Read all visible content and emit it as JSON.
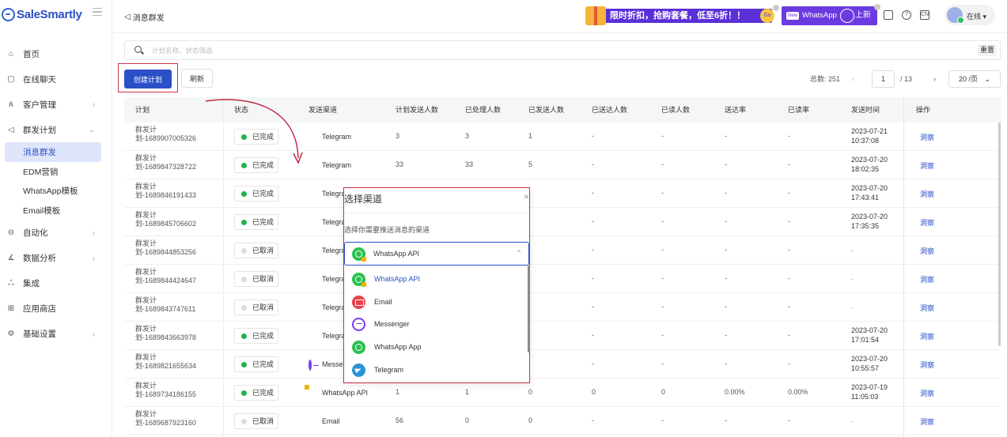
{
  "app": {
    "logo": "SaleSmartly"
  },
  "sidebar": {
    "items": [
      {
        "label": "首页",
        "icon": "home-icon",
        "glyph": "⌂"
      },
      {
        "label": "在线聊天",
        "icon": "chat-icon",
        "glyph": "▢"
      },
      {
        "label": "客户管理",
        "icon": "users-icon",
        "glyph": "ጰ",
        "chev": "›"
      },
      {
        "label": "群发计划",
        "icon": "send-icon",
        "glyph": "◁",
        "chev": "⌄"
      },
      {
        "label": "自动化",
        "icon": "automation-icon",
        "glyph": "⊖",
        "chev": "›"
      },
      {
        "label": "数据分析",
        "icon": "analytics-icon",
        "glyph": "∡",
        "chev": "›"
      },
      {
        "label": "集成",
        "icon": "integration-icon",
        "glyph": "ஃ"
      },
      {
        "label": "应用商店",
        "icon": "store-icon",
        "glyph": "⊞"
      },
      {
        "label": "基础设置",
        "icon": "settings-icon",
        "glyph": "⚙",
        "chev": "›"
      }
    ],
    "sub_items": [
      "消息群发",
      "EDM营销",
      "WhatsApp模板",
      "Email模板"
    ]
  },
  "topbar": {
    "title": "消息群发",
    "promo_text": "限时折扣，抢购套餐，低至6折！！",
    "promo_badge": "Go",
    "wa_new": "New",
    "wa_label": "WhatsApp",
    "wa_suffix": "上新",
    "icon_cn": "CN",
    "icon_help": "?",
    "user_status": "在线"
  },
  "search": {
    "placeholder": "计划名称、状态筛选",
    "reset": "重置"
  },
  "toolbar": {
    "create": "创建计划",
    "refresh": "刷新"
  },
  "pager": {
    "total_label": "总数: 251",
    "prev": "‹",
    "page": "1",
    "of": "/ 13",
    "next": "›",
    "page_size": "20 /页",
    "page_size_chev": "⌄"
  },
  "table": {
    "headers": [
      "计划",
      "状态",
      "发送渠道",
      "计划发送人数",
      "已处理人数",
      "已发送人数",
      "已送达人数",
      "已读人数",
      "送达率",
      "已读率",
      "发送时间",
      "操作"
    ],
    "rows": [
      {
        "plan1": "群发计",
        "plan2": "划-1689907005326",
        "status": "已完成",
        "dot": "green",
        "channel": "Telegram",
        "ch": "tg",
        "plan_n": "3",
        "proc": "3",
        "sent": "1",
        "deliv": "-",
        "read": "-",
        "drate": "-",
        "rrate": "-",
        "t1": "2023-07-21",
        "t2": "10:37:08",
        "op": "洞察"
      },
      {
        "plan1": "群发计",
        "plan2": "划-1689847328722",
        "status": "已完成",
        "dot": "green",
        "channel": "Telegram",
        "ch": "tg",
        "plan_n": "33",
        "proc": "33",
        "sent": "5",
        "deliv": "-",
        "read": "-",
        "drate": "-",
        "rrate": "-",
        "t1": "2023-07-20",
        "t2": "18:02:35",
        "op": "洞察"
      },
      {
        "plan1": "群发计",
        "plan2": "划-1689846191433",
        "status": "已完成",
        "dot": "green",
        "channel": "Telegram",
        "ch": "tg",
        "plan_n": "",
        "proc": "",
        "sent": "",
        "deliv": "-",
        "read": "-",
        "drate": "-",
        "rrate": "-",
        "t1": "2023-07-20",
        "t2": "17:43:41",
        "op": "洞察"
      },
      {
        "plan1": "群发计",
        "plan2": "划-1689845706602",
        "status": "已完成",
        "dot": "green",
        "channel": "Telegram",
        "ch": "tg",
        "plan_n": "",
        "proc": "",
        "sent": "",
        "deliv": "-",
        "read": "-",
        "drate": "-",
        "rrate": "-",
        "t1": "2023-07-20",
        "t2": "17:35:35",
        "op": "洞察"
      },
      {
        "plan1": "群发计",
        "plan2": "划-1689844853256",
        "status": "已取消",
        "dot": "grey",
        "channel": "Telegram",
        "ch": "tg",
        "plan_n": "",
        "proc": "",
        "sent": "",
        "deliv": "-",
        "read": "-",
        "drate": "-",
        "rrate": "-",
        "t1": "-",
        "t2": "",
        "op": "洞察"
      },
      {
        "plan1": "群发计",
        "plan2": "划-1689844424647",
        "status": "已取消",
        "dot": "grey",
        "channel": "Telegram",
        "ch": "tg",
        "plan_n": "",
        "proc": "",
        "sent": "",
        "deliv": "-",
        "read": "-",
        "drate": "-",
        "rrate": "-",
        "t1": "-",
        "t2": "",
        "op": "洞察"
      },
      {
        "plan1": "群发计",
        "plan2": "划-1689843747611",
        "status": "已取消",
        "dot": "grey",
        "channel": "Telegram",
        "ch": "tg",
        "plan_n": "",
        "proc": "",
        "sent": "",
        "deliv": "-",
        "read": "-",
        "drate": "-",
        "rrate": "-",
        "t1": "-",
        "t2": "",
        "op": "洞察"
      },
      {
        "plan1": "群发计",
        "plan2": "划-1689843663978",
        "status": "已完成",
        "dot": "green",
        "channel": "Telegram",
        "ch": "tg",
        "plan_n": "",
        "proc": "",
        "sent": "",
        "deliv": "-",
        "read": "-",
        "drate": "-",
        "rrate": "-",
        "t1": "2023-07-20",
        "t2": "17:01:54",
        "op": "洞察"
      },
      {
        "plan1": "群发计",
        "plan2": "划-1689821655634",
        "status": "已完成",
        "dot": "green",
        "channel": "Messenger",
        "ch": "msg",
        "plan_n": "",
        "proc": "",
        "sent": "",
        "deliv": "-",
        "read": "-",
        "drate": "-",
        "rrate": "-",
        "t1": "2023-07-20",
        "t2": "10:55:57",
        "op": "洞察"
      },
      {
        "plan1": "群发计",
        "plan2": "划-1689734186155",
        "status": "已完成",
        "dot": "green",
        "channel": "WhatsApp API",
        "ch": "wa",
        "plan_n": "1",
        "proc": "1",
        "sent": "0",
        "deliv": "0",
        "read": "0",
        "drate": "0.00%",
        "rrate": "0.00%",
        "t1": "2023-07-19",
        "t2": "11:05:03",
        "op": "洞察"
      },
      {
        "plan1": "群发计",
        "plan2": "划-1689687923160",
        "status": "已取消",
        "dot": "grey",
        "channel": "Email",
        "ch": "mail",
        "plan_n": "56",
        "proc": "0",
        "sent": "0",
        "deliv": "-",
        "read": "-",
        "drate": "-",
        "rrate": "-",
        "t1": "-",
        "t2": "",
        "op": "洞察"
      }
    ]
  },
  "modal": {
    "title": "选择渠道",
    "close": "×",
    "desc": "选择你需要推送消息的渠道",
    "selected": "WhatsApp API",
    "select_chev": "⌃",
    "options": [
      {
        "label": "WhatsApp API",
        "icon": "wa-api",
        "selected": true
      },
      {
        "label": "Email",
        "icon": "mail"
      },
      {
        "label": "Messenger",
        "icon": "msg"
      },
      {
        "label": "WhatsApp App",
        "icon": "wa"
      },
      {
        "label": "Telegram",
        "icon": "tg"
      }
    ]
  },
  "colors": {
    "primary": "#2b4fc7",
    "highlight": "#c9324a",
    "success": "#22b14c",
    "promo": "#5a2fd8"
  }
}
